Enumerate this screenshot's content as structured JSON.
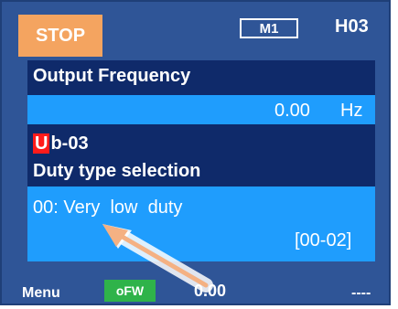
{
  "header": {
    "status": "STOP",
    "mode": "M1",
    "code": "H03"
  },
  "display": {
    "output_label": "Output Frequency",
    "output_value": "0.00",
    "output_unit": "Hz",
    "param_prefix": "U",
    "param_rest": "b-03",
    "param_title": "Duty type selection",
    "selected_value": "00: Very  low  duty",
    "range": "[00-02]"
  },
  "footer": {
    "menu_label": "Menu",
    "badge": "oFW",
    "value": "0.00",
    "right": "----"
  },
  "colors": {
    "frame": "#2f5597",
    "lcd_dark": "#0f2a6a",
    "lcd_light": "#1f9dfd",
    "stop_bg": "#f4a460",
    "badge_bg": "#2fb34a",
    "accent_red": "#ff1b1b",
    "arrow": "#f4b183"
  },
  "icons": {
    "pointer": "arrow-pointer-icon"
  }
}
